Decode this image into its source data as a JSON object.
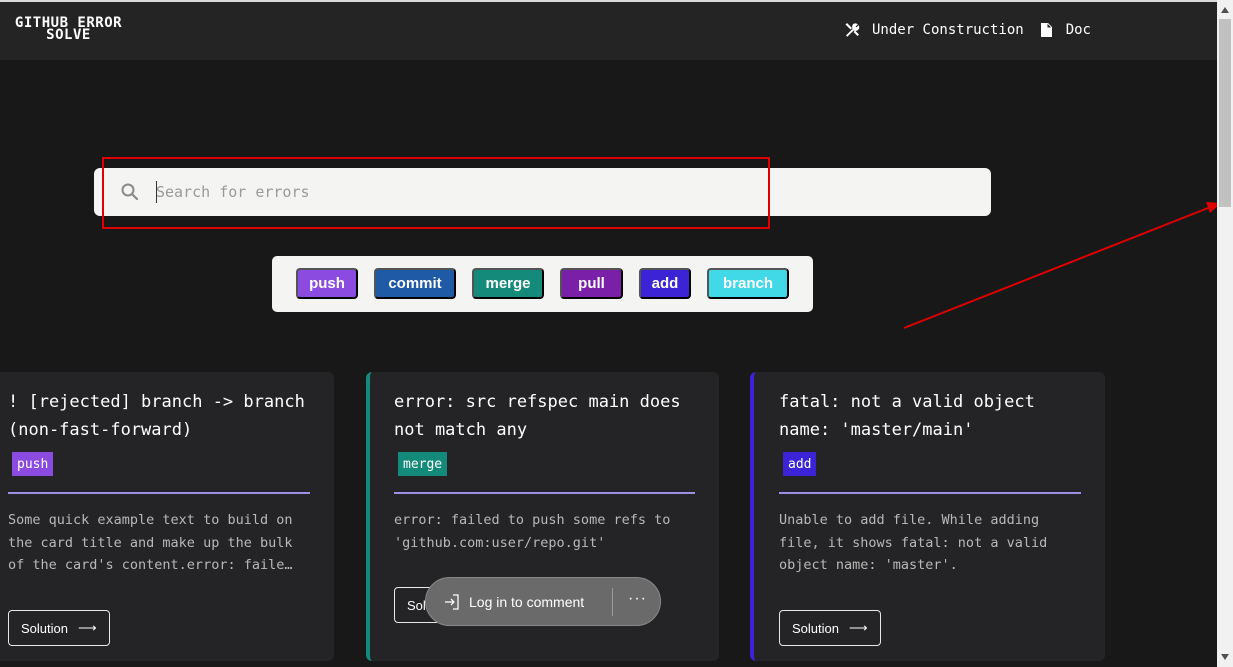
{
  "navbar": {
    "logo_line1": "GITHUB ERROR",
    "logo_line2": "SOLVE",
    "links": [
      {
        "label": "Under Construction",
        "icon": "tools-icon"
      },
      {
        "label": "Doc",
        "icon": "document-icon"
      }
    ]
  },
  "search": {
    "placeholder": "Search for errors",
    "value": ""
  },
  "tags": [
    {
      "label": "push",
      "color": "#8b4be0"
    },
    {
      "label": "commit",
      "color": "#1f5aa6"
    },
    {
      "label": "merge",
      "color": "#148b7a"
    },
    {
      "label": "pull",
      "color": "#7a1fa8"
    },
    {
      "label": "add",
      "color": "#3d23d6"
    },
    {
      "label": "branch",
      "color": "#41d9e8"
    }
  ],
  "cards": [
    {
      "title": "! [rejected] branch -> branch (non-fast-forward)",
      "tag": "push",
      "tag_color": "#8b4be0",
      "text": "Some quick example text to build on the card title and make up the bulk of the card's content.error: faile…",
      "button": "Solution"
    },
    {
      "title": "error: src refspec main does not match any",
      "tag": "merge",
      "tag_color": "#148b7a",
      "accent_color": "#148b7a",
      "text": "error: failed to push some refs to 'github.com:user/repo.git'",
      "button": "Solution"
    },
    {
      "title": "fatal: not a valid object name: 'master/main'",
      "tag": "add",
      "tag_color": "#3d23d6",
      "accent_color": "#3d23d6",
      "text": "Unable to add file. While adding file, it shows fatal: not a valid object name: 'master'.",
      "button": "Solution"
    }
  ],
  "comment_bar": {
    "login_label": "Log in to comment",
    "more_label": "···"
  },
  "colors": {
    "background": "#181818",
    "navbar": "#242424",
    "card": "#242426",
    "divider": "#9d8ee8",
    "annotation": "#e00000"
  }
}
